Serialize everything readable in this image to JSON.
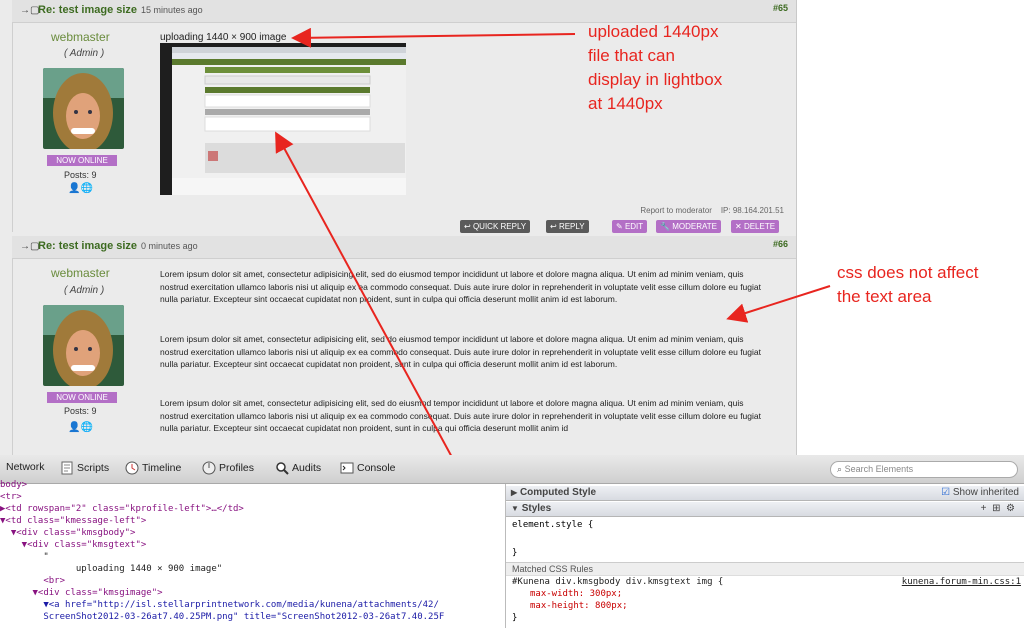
{
  "posts": [
    {
      "subject": "Re: test image size",
      "time": "15 minutes ago",
      "number": "#65",
      "username": "webmaster",
      "role": "( Admin )",
      "online": "NOW ONLINE",
      "posts_label": "Posts: 9",
      "message_title": "uploading 1440 × 900 image",
      "report": "Report to moderator",
      "ip": "IP: 98.164.201.51",
      "buttons": [
        "QUICK REPLY",
        "REPLY",
        "EDIT",
        "MODERATE",
        "DELETE"
      ]
    },
    {
      "subject": "Re: test image size",
      "time": "0 minutes ago",
      "number": "#66",
      "username": "webmaster",
      "role": "( Admin )",
      "online": "NOW ONLINE",
      "posts_label": "Posts: 9",
      "paragraphs": [
        "Lorem ipsum dolor sit amet, consectetur adipisicing elit, sed do eiusmod tempor incididunt ut labore et dolore magna aliqua. Ut enim ad minim veniam, quis nostrud exercitation ullamco laboris nisi ut aliquip ex ea commodo consequat. Duis aute irure dolor in reprehenderit in voluptate velit esse cillum dolore eu fugiat nulla pariatur. Excepteur sint occaecat cupidatat non proident, sunt in culpa qui officia deserunt mollit anim id est laborum.",
        "Lorem ipsum dolor sit amet, consectetur adipisicing elit, sed do eiusmod tempor incididunt ut labore et dolore magna aliqua. Ut enim ad minim veniam, quis nostrud exercitation ullamco laboris nisi ut aliquip ex ea commodo consequat. Duis aute irure dolor in reprehenderit in voluptate velit esse cillum dolore eu fugiat nulla pariatur. Excepteur sint occaecat cupidatat non proident, sunt in culpa qui officia deserunt mollit anim id est laborum.",
        "Lorem ipsum dolor sit amet, consectetur adipisicing elit, sed do eiusmod tempor incididunt ut labore et dolore magna aliqua. Ut enim ad minim veniam, quis nostrud exercitation ullamco laboris nisi ut aliquip ex ea commodo consequat. Duis aute irure dolor in reprehenderit in voluptate velit esse cillum dolore eu fugiat nulla pariatur. Excepteur sint occaecat cupidatat non proident, sunt in culpa qui officia deserunt mollit anim id"
      ]
    }
  ],
  "annotations": {
    "first": [
      "uploaded 1440px",
      "file that can",
      "display in lightbox",
      "at 1440px"
    ],
    "second": [
      "css does not affect",
      "the text area"
    ],
    "color": "#e8251f"
  },
  "devtools": {
    "tabs": [
      "Network",
      "Scripts",
      "Timeline",
      "Profiles",
      "Audits",
      "Console"
    ],
    "search_placeholder": "Search Elements",
    "dom_lines": [
      "body>",
      "<tr>",
      "▶<td rowspan=\"2\" class=\"kprofile-left\">…</td>",
      "▼<td class=\"kmessage-left\">",
      "  ▼<div class=\"kmsgbody\">",
      "    ▼<div class=\"kmsgtext\">",
      "        \"",
      "              uploading 1440 × 900 image\"",
      "        <br>",
      "      ▼<div class=\"kmsgimage\">",
      "        ▼<a href=\"http://isl.stellarprintnetwork.com/media/kunena/attachments/42/",
      "        ScreenShot2012-03-26at7.40.25PM.png\" title=\"ScreenShot2012-03-26at7.40.25F"
    ],
    "computed_style": "Computed Style",
    "show_inherited": "Show inherited",
    "styles": "Styles",
    "element_style": "element.style {",
    "close_brace": "}",
    "matched_rules": "Matched CSS Rules",
    "rule_selector": "#Kunena div.kmsgbody div.kmsgtext img {",
    "rule_source": "kunena.forum-min.css:1",
    "rule_props": [
      "max-width: 300px;",
      "max-height: 800px;"
    ]
  },
  "colors": {
    "accent_purple": "#b36fc6",
    "username_green": "#6a8c3d",
    "subject_green": "#3d6b21"
  }
}
